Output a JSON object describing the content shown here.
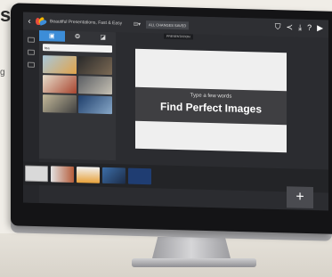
{
  "page": {
    "heading_fragment": "s",
    "side_fragment": "g"
  },
  "app": {
    "document_title": "Beautiful Presentations, Fast & Easy",
    "saved_status": "ALL CHANGES SAVED",
    "toolbar_tip": "PRESENTATION"
  },
  "panel": {
    "search_value": "tea"
  },
  "slide": {
    "subtitle": "Type a few words",
    "title": "Find Perfect Images"
  },
  "add_label": "+",
  "colors": {
    "accent": "#3c8dd8",
    "screen": "#2b2c30",
    "slide_band": "#3f3f42"
  },
  "icons": [
    "back-arrow-icon",
    "shield-icon",
    "share-icon",
    "download-icon",
    "help-icon",
    "play-icon",
    "add-icon"
  ]
}
